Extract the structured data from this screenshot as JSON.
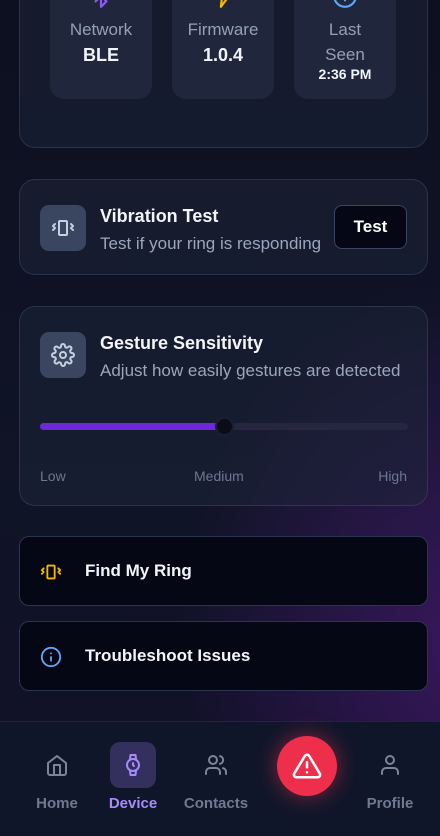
{
  "stats": [
    {
      "label": "Network",
      "value": "BLE",
      "icon": "bluetooth-icon",
      "color": "#8b5cf6"
    },
    {
      "label": "Firmware",
      "value": "1.0.4",
      "icon": "lightning-icon",
      "color": "#f5b800"
    },
    {
      "label": "Last Seen",
      "value": "2:36 PM",
      "icon": "info-icon",
      "color": "#60a5fa"
    }
  ],
  "vibration": {
    "title": "Vibration Test",
    "subtitle": "Test if your ring is responding",
    "button": "Test"
  },
  "gesture": {
    "title": "Gesture Sensitivity",
    "subtitle": "Adjust how easily gestures are detected",
    "level": 0.5,
    "labels": {
      "low": "Low",
      "medium": "Medium",
      "high": "High"
    }
  },
  "actions": {
    "find": "Find My Ring",
    "troubleshoot": "Troubleshoot Issues"
  },
  "nav": {
    "home": "Home",
    "device": "Device",
    "contacts": "Contacts",
    "profile": "Profile",
    "active": "Device"
  },
  "colors": {
    "accent": "#7c3aed",
    "sos": "#ee2f4b"
  }
}
